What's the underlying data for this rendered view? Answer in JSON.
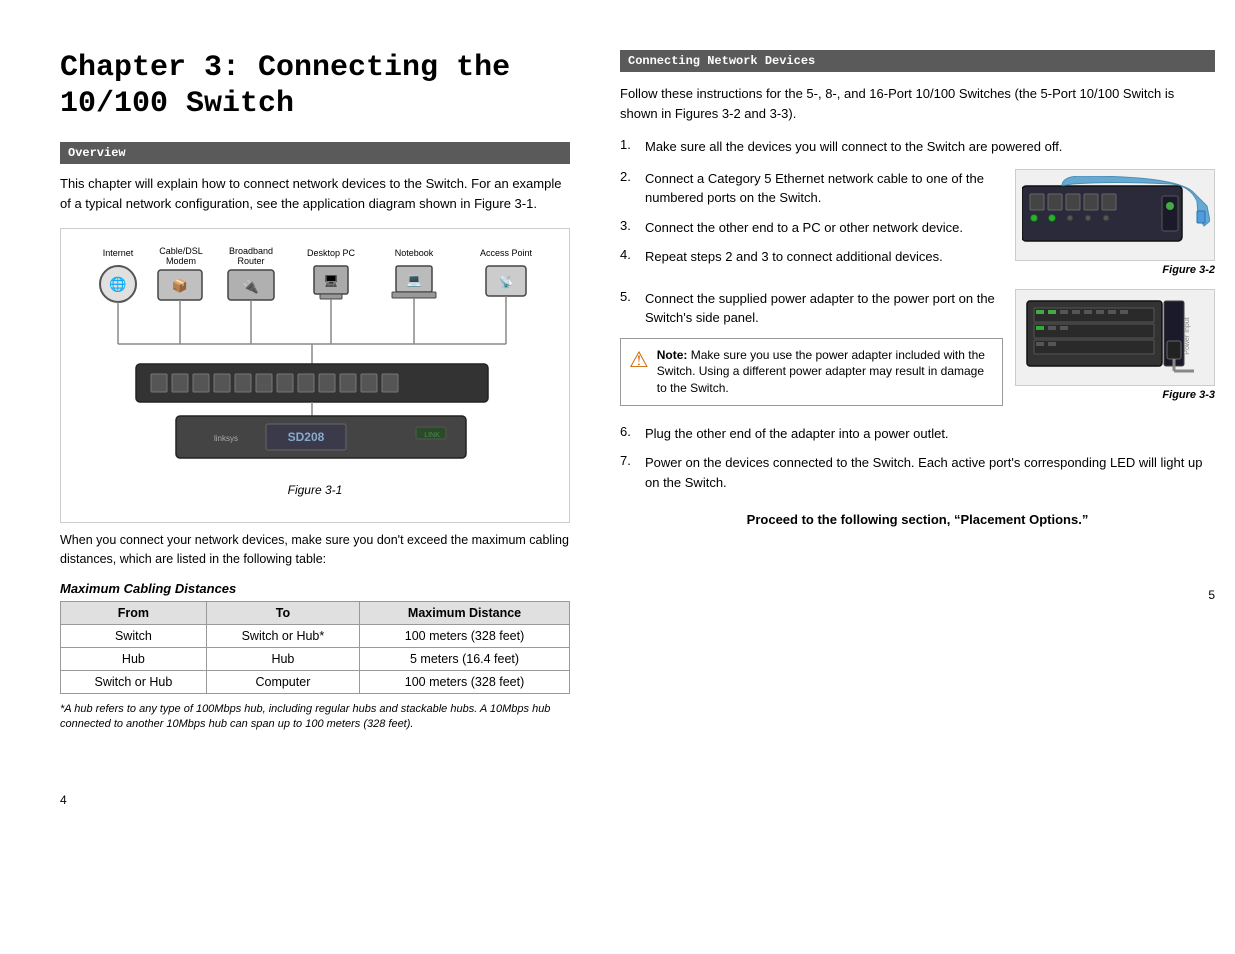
{
  "left": {
    "chapter_title_line1": "Chapter 3: Connecting the",
    "chapter_title_line2": "10/100 Switch",
    "overview_header": "Overview",
    "overview_text": "This chapter will explain how to connect network devices to the Switch. For an example of a typical network configuration, see the application diagram shown in Figure 3-1.",
    "figure1_label": "Figure 3-1",
    "cabling_text": "When you connect your network devices, make sure you don't exceed the maximum cabling distances, which are listed in the following table:",
    "table_title": "Maximum Cabling Distances",
    "table": {
      "headers": [
        "From",
        "To",
        "Maximum Distance"
      ],
      "rows": [
        [
          "Switch",
          "Switch or Hub*",
          "100 meters (328 feet)"
        ],
        [
          "Hub",
          "Hub",
          "5 meters (16.4 feet)"
        ],
        [
          "Switch or Hub",
          "Computer",
          "100 meters (328 feet)"
        ]
      ]
    },
    "footnote": "*A hub refers to any type of 100Mbps hub, including regular hubs and stackable hubs. A 10Mbps hub connected to another 10Mbps hub can span up to 100 meters (328 feet).",
    "page_num": "4",
    "devices": {
      "internet": "Internet",
      "modem": "Cable/DSL\nModem",
      "router": "Broadband\nRouter",
      "desktop": "Desktop PC",
      "notebook": "Notebook",
      "ap": "Access Point"
    }
  },
  "right": {
    "section_header": "Connecting Network Devices",
    "intro_text": "Follow these instructions for the 5-, 8-, and 16-Port 10/100 Switches (the 5-Port 10/100 Switch is shown in Figures 3-2 and 3-3).",
    "steps": [
      {
        "num": "1.",
        "text": "Make sure all the devices you will connect to the Switch are powered off."
      },
      {
        "num": "2.",
        "text": "Connect a Category 5 Ethernet network cable to one of the numbered ports on the Switch."
      },
      {
        "num": "3.",
        "text": "Connect the other end to a PC or other network device."
      },
      {
        "num": "4.",
        "text": "Repeat steps 2 and 3 to connect additional devices."
      },
      {
        "num": "5.",
        "text": "Connect the supplied power adapter to the power port on the Switch's side panel."
      },
      {
        "num": "6.",
        "text": "Plug the other end of the adapter into a power outlet."
      },
      {
        "num": "7.",
        "text": "Power on the devices connected to the Switch. Each active port's corresponding LED will light up on the Switch."
      }
    ],
    "figure2_label": "Figure 3-2",
    "figure3_label": "Figure 3-3",
    "note_label": "Note:",
    "note_text": "Make sure you use the power adapter included with the Switch. Using a different power adapter may result in damage to the Switch.",
    "proceed_text": "Proceed to the following section, “Placement Options.”",
    "page_num": "5"
  }
}
